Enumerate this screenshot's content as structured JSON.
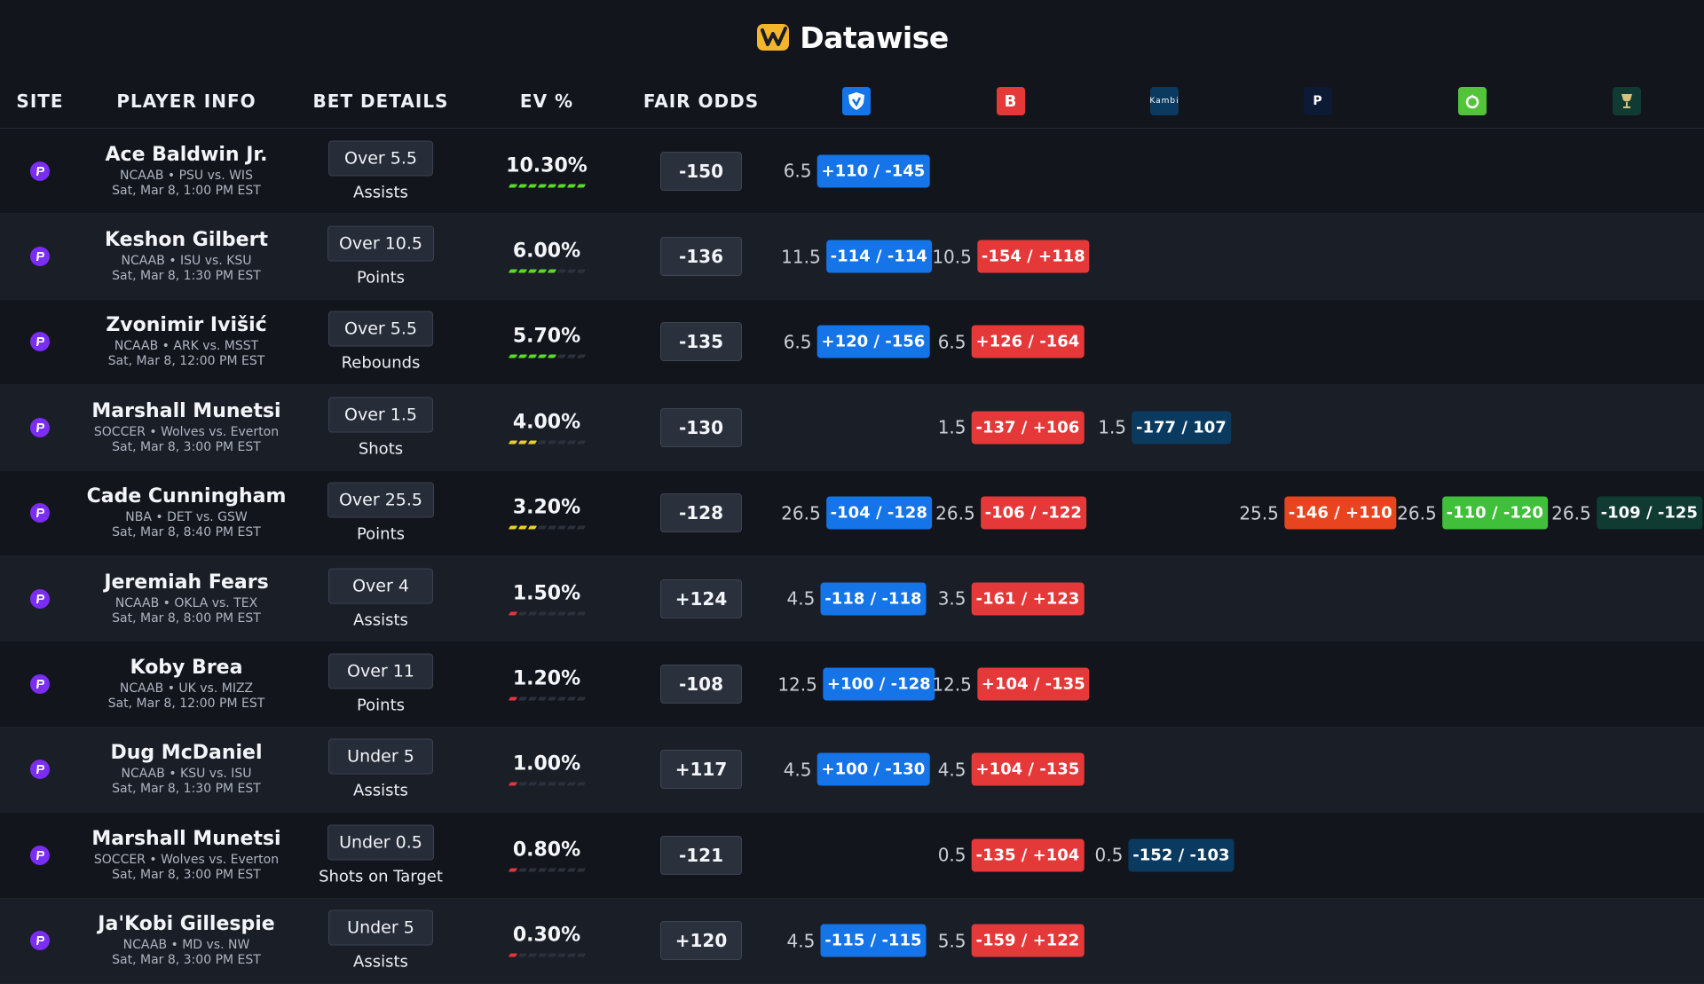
{
  "app": {
    "title": "Datawise"
  },
  "columns": {
    "site": "SITE",
    "player_info": "PLAYER INFO",
    "bet_details": "BET DETAILS",
    "ev": "EV %",
    "fair_odds": "FAIR ODDS"
  },
  "books": [
    {
      "key": "fanduel",
      "icon": "shield-icon",
      "glyph": "",
      "color": "#1474e8"
    },
    {
      "key": "betrivers",
      "icon": "b-icon",
      "glyph": "B",
      "color": "#e53939"
    },
    {
      "key": "kambi",
      "icon": "kambi-icon",
      "glyph": "Kambi",
      "color": "#0b3a61"
    },
    {
      "key": "pinnacle",
      "icon": "p-icon",
      "glyph": "P",
      "color": "#0d1a33"
    },
    {
      "key": "draftkings",
      "icon": "dk-icon",
      "glyph": "",
      "color": "#53c43a"
    },
    {
      "key": "circa",
      "icon": "trophy-icon",
      "glyph": "",
      "color": "#0f3b33"
    }
  ],
  "colors": {
    "fanduel": "#1474e8",
    "betrivers": "#e53939",
    "kambi": "#0b3a61",
    "fanatics": "#e8441f",
    "draftkings": "#3fbf3a",
    "circa": "#0f3b33",
    "bar_green": "#5ad82b",
    "bar_yellow": "#e6cf2a",
    "bar_red": "#e5343c"
  },
  "rows": [
    {
      "name": "Ace Baldwin Jr.",
      "game": "NCAAB • PSU vs. WIS",
      "time": "Sat, Mar 8, 1:00 PM EST",
      "bet_line": "Over 5.5",
      "bet_type": "Assists",
      "ev": "10.30%",
      "ev_fill": 8,
      "ev_color": "green",
      "fair": "-150",
      "odds": [
        {
          "col": 0,
          "line": "6.5",
          "price": "+110 / -145",
          "color": "fanduel"
        }
      ]
    },
    {
      "name": "Keshon Gilbert",
      "game": "NCAAB • ISU vs. KSU",
      "time": "Sat, Mar 8, 1:30 PM EST",
      "bet_line": "Over 10.5",
      "bet_type": "Points",
      "ev": "6.00%",
      "ev_fill": 5,
      "ev_color": "green",
      "fair": "-136",
      "odds": [
        {
          "col": 0,
          "line": "11.5",
          "price": "-114 / -114",
          "color": "fanduel"
        },
        {
          "col": 1,
          "line": "10.5",
          "price": "-154 / +118",
          "color": "betrivers"
        }
      ]
    },
    {
      "name": "Zvonimir Ivišić",
      "game": "NCAAB • ARK vs. MSST",
      "time": "Sat, Mar 8, 12:00 PM EST",
      "bet_line": "Over 5.5",
      "bet_type": "Rebounds",
      "ev": "5.70%",
      "ev_fill": 5,
      "ev_color": "green",
      "fair": "-135",
      "odds": [
        {
          "col": 0,
          "line": "6.5",
          "price": "+120 / -156",
          "color": "fanduel"
        },
        {
          "col": 1,
          "line": "6.5",
          "price": "+126 / -164",
          "color": "betrivers"
        }
      ]
    },
    {
      "name": "Marshall Munetsi",
      "game": "SOCCER • Wolves vs. Everton",
      "time": "Sat, Mar 8, 3:00 PM EST",
      "bet_line": "Over 1.5",
      "bet_type": "Shots",
      "ev": "4.00%",
      "ev_fill": 3,
      "ev_color": "yellow",
      "fair": "-130",
      "odds": [
        {
          "col": 1,
          "line": "1.5",
          "price": "-137 / +106",
          "color": "betrivers"
        },
        {
          "col": 2,
          "line": "1.5",
          "price": "-177 / 107",
          "color": "kambi"
        }
      ]
    },
    {
      "name": "Cade Cunningham",
      "game": "NBA • DET vs. GSW",
      "time": "Sat, Mar 8, 8:40 PM EST",
      "bet_line": "Over 25.5",
      "bet_type": "Points",
      "ev": "3.20%",
      "ev_fill": 3,
      "ev_color": "yellow",
      "fair": "-128",
      "odds": [
        {
          "col": 0,
          "line": "26.5",
          "price": "-104 / -128",
          "color": "fanduel"
        },
        {
          "col": 1,
          "line": "26.5",
          "price": "-106 / -122",
          "color": "betrivers"
        },
        {
          "col": 3,
          "line": "25.5",
          "price": "-146 / +110",
          "color": "fanatics"
        },
        {
          "col": 4,
          "line": "26.5",
          "price": "-110 / -120",
          "color": "draftkings"
        },
        {
          "col": 5,
          "line": "26.5",
          "price": "-109 / -125",
          "color": "circa"
        }
      ]
    },
    {
      "name": "Jeremiah Fears",
      "game": "NCAAB • OKLA vs. TEX",
      "time": "Sat, Mar 8, 8:00 PM EST",
      "bet_line": "Over 4",
      "bet_type": "Assists",
      "ev": "1.50%",
      "ev_fill": 1,
      "ev_color": "red",
      "fair": "+124",
      "odds": [
        {
          "col": 0,
          "line": "4.5",
          "price": "-118 / -118",
          "color": "fanduel"
        },
        {
          "col": 1,
          "line": "3.5",
          "price": "-161 / +123",
          "color": "betrivers"
        }
      ]
    },
    {
      "name": "Koby Brea",
      "game": "NCAAB • UK vs. MIZZ",
      "time": "Sat, Mar 8, 12:00 PM EST",
      "bet_line": "Over 11",
      "bet_type": "Points",
      "ev": "1.20%",
      "ev_fill": 1,
      "ev_color": "red",
      "fair": "-108",
      "odds": [
        {
          "col": 0,
          "line": "12.5",
          "price": "+100 / -128",
          "color": "fanduel"
        },
        {
          "col": 1,
          "line": "12.5",
          "price": "+104 / -135",
          "color": "betrivers"
        }
      ]
    },
    {
      "name": "Dug McDaniel",
      "game": "NCAAB • KSU vs. ISU",
      "time": "Sat, Mar 8, 1:30 PM EST",
      "bet_line": "Under 5",
      "bet_type": "Assists",
      "ev": "1.00%",
      "ev_fill": 1,
      "ev_color": "red",
      "fair": "+117",
      "odds": [
        {
          "col": 0,
          "line": "4.5",
          "price": "+100 / -130",
          "color": "fanduel"
        },
        {
          "col": 1,
          "line": "4.5",
          "price": "+104 / -135",
          "color": "betrivers"
        }
      ]
    },
    {
      "name": "Marshall Munetsi",
      "game": "SOCCER • Wolves vs. Everton",
      "time": "Sat, Mar 8, 3:00 PM EST",
      "bet_line": "Under 0.5",
      "bet_type": "Shots on Target",
      "ev": "0.80%",
      "ev_fill": 1,
      "ev_color": "red",
      "fair": "-121",
      "odds": [
        {
          "col": 1,
          "line": "0.5",
          "price": "-135 / +104",
          "color": "betrivers"
        },
        {
          "col": 2,
          "line": "0.5",
          "price": "-152 / -103",
          "color": "kambi"
        }
      ]
    },
    {
      "name": "Ja'Kobi Gillespie",
      "game": "NCAAB • MD vs. NW",
      "time": "Sat, Mar 8, 3:00 PM EST",
      "bet_line": "Under 5",
      "bet_type": "Assists",
      "ev": "0.30%",
      "ev_fill": 1,
      "ev_color": "red",
      "fair": "+120",
      "odds": [
        {
          "col": 0,
          "line": "4.5",
          "price": "-115 / -115",
          "color": "fanduel"
        },
        {
          "col": 1,
          "line": "5.5",
          "price": "-159 / +122",
          "color": "betrivers"
        }
      ]
    }
  ]
}
